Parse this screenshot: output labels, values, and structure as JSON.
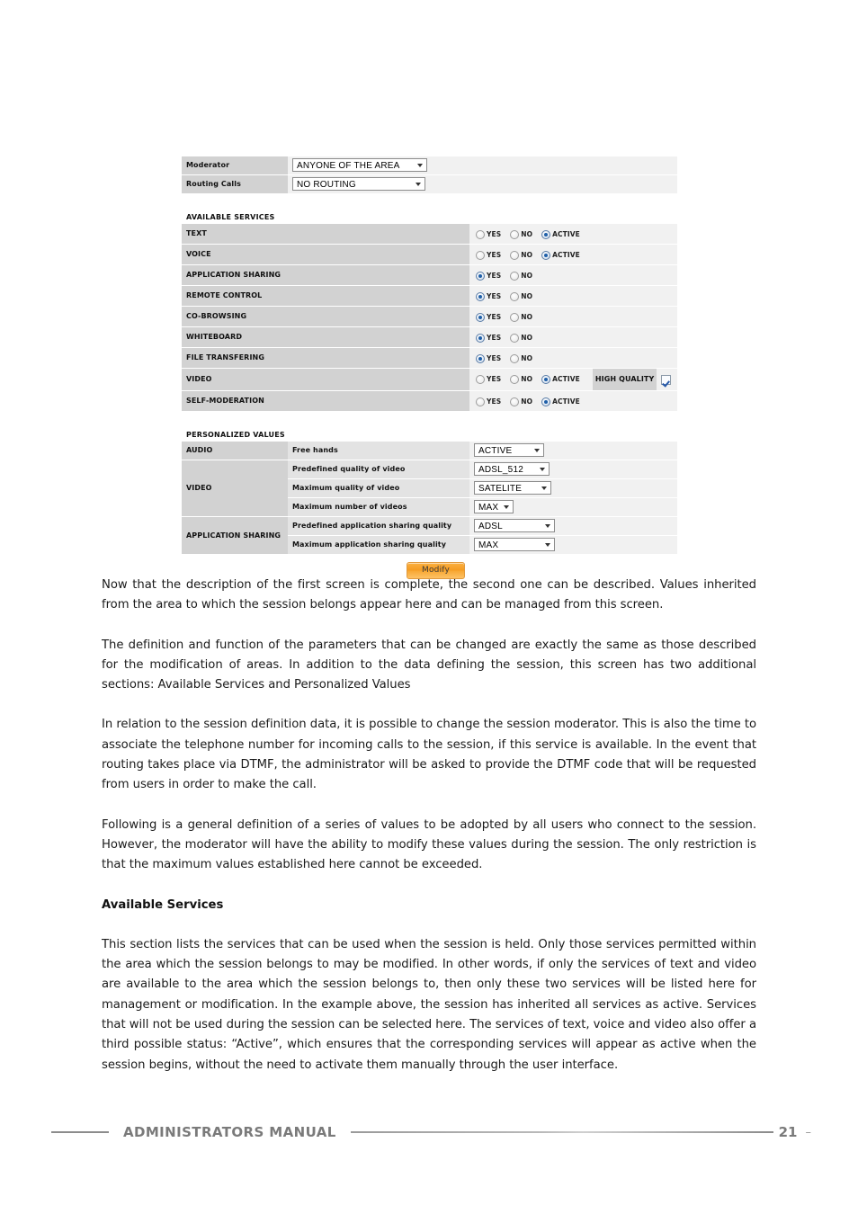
{
  "screenshot": {
    "top_fields": [
      {
        "label": "Moderator",
        "value": "ANYONE OF THE AREA",
        "width_class": "sel-w150"
      },
      {
        "label": "Routing Calls",
        "value": "NO ROUTING",
        "width_class": "sel-w148"
      }
    ],
    "available_services": {
      "section_title": "AVAILABLE SERVICES",
      "option_labels": {
        "yes": "YES",
        "no": "NO",
        "active": "ACTIVE"
      },
      "high_quality_label": "HIGH QUALITY",
      "rows": [
        {
          "label": "TEXT",
          "options": [
            "YES",
            "NO",
            "ACTIVE"
          ],
          "selected": "ACTIVE",
          "high_quality": null
        },
        {
          "label": "VOICE",
          "options": [
            "YES",
            "NO",
            "ACTIVE"
          ],
          "selected": "ACTIVE",
          "high_quality": null
        },
        {
          "label": "APPLICATION SHARING",
          "options": [
            "YES",
            "NO"
          ],
          "selected": "YES",
          "high_quality": null
        },
        {
          "label": "REMOTE CONTROL",
          "options": [
            "YES",
            "NO"
          ],
          "selected": "YES",
          "high_quality": null
        },
        {
          "label": "CO-BROWSING",
          "options": [
            "YES",
            "NO"
          ],
          "selected": "YES",
          "high_quality": null
        },
        {
          "label": "WHITEBOARD",
          "options": [
            "YES",
            "NO"
          ],
          "selected": "YES",
          "high_quality": null
        },
        {
          "label": "FILE TRANSFERING",
          "options": [
            "YES",
            "NO"
          ],
          "selected": "YES",
          "high_quality": null
        },
        {
          "label": "VIDEO",
          "options": [
            "YES",
            "NO",
            "ACTIVE"
          ],
          "selected": "ACTIVE",
          "high_quality": true
        },
        {
          "label": "SELF-MODERATION",
          "options": [
            "YES",
            "NO",
            "ACTIVE"
          ],
          "selected": "ACTIVE",
          "high_quality": null
        }
      ]
    },
    "personalized_values": {
      "section_title": "PERSONALIZED VALUES",
      "groups": [
        {
          "group": "AUDIO",
          "rows": [
            {
              "name": "Free hands",
              "value": "ACTIVE",
              "width_class": "sel-w78"
            }
          ]
        },
        {
          "group": "VIDEO",
          "rows": [
            {
              "name": "Predefined quality of video",
              "value": "ADSL_512",
              "width_class": "sel-w84"
            },
            {
              "name": "Maximum quality of video",
              "value": "SATELITE",
              "width_class": "sel-w86"
            },
            {
              "name": "Maximum number of videos",
              "value": "MAX",
              "width_class": "sel-w44"
            }
          ]
        },
        {
          "group": "APPLICATION SHARING",
          "rows": [
            {
              "name": "Predefined application sharing quality",
              "value": "ADSL",
              "width_class": "sel-w90"
            },
            {
              "name": "Maximum application sharing quality",
              "value": "MAX",
              "width_class": "sel-w90"
            }
          ]
        }
      ]
    },
    "modify_button": "Modify"
  },
  "document": {
    "paragraphs": [
      "Now that the description of the first screen is complete, the second one can be described. Values inherited from the area to which the session belongs appear here and can be managed from this screen.",
      "The definition and function of the parameters that can be changed are exactly the same as those described for the modification of areas. In addition to the data defining the session, this screen has two additional sections: Available Services and Personalized Values",
      "In relation to the session definition data, it is possible to change the session moderator. This is also the time to associate the telephone number for incoming calls to the session, if this service is available. In the event that routing takes place via DTMF, the administrator will be asked to provide the DTMF code that will be requested from users in order to make the call.",
      "Following is a general definition of a series of values to be adopted by all users who connect to the session. However, the moderator will have the ability to modify these values during the session. The only restriction is that the maximum values established here cannot be exceeded."
    ],
    "heading": "Available Services",
    "final_paragraph": "This section lists the services that can be used when the session is held. Only those services permitted within the area which the session belongs to may be modified. In other words, if only the services of text and video are available to the area which the session belongs to, then only these two services will be listed here for management or modification. In the example above, the session has inherited all services as active. Services that will not be used during the session can be selected here. The services of text, voice and video also offer a third possible status: “Active”, which ensures that the corresponding services will appear as active when the session begins, without the need to activate them manually through the user interface."
  },
  "footer": {
    "title": "ADMINISTRATORS MANUAL",
    "page_number": "21",
    "trailing_dash": "–"
  },
  "colors": {
    "label_cell": "#d2d2d2",
    "value_cell": "#f1f1f1",
    "sub_cell": "#e3e3e3",
    "radio_selected": "#1f5fa8",
    "button_orange": "#f59b22",
    "footer_gray": "#7a7a7a"
  }
}
